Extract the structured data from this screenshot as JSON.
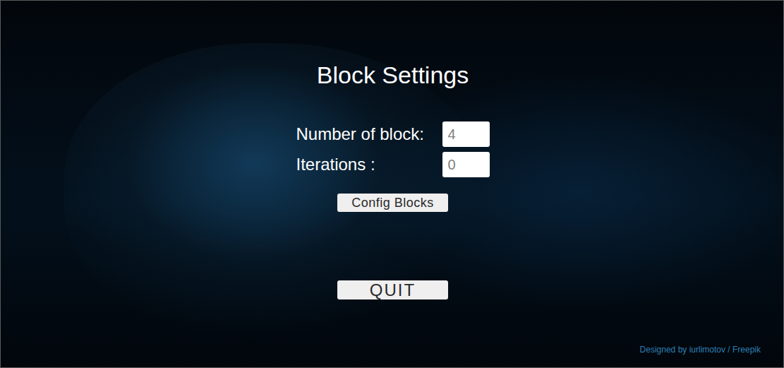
{
  "heading": "Block Settings",
  "fields": [
    {
      "label": "Number of block:",
      "value": "4"
    },
    {
      "label": "Iterations :",
      "value": "0"
    }
  ],
  "buttons": [
    {
      "label": "Config Blocks",
      "kind": "small"
    },
    {
      "label": "QUIT",
      "kind": "large"
    }
  ],
  "credit": "Designed by iurlimotov / Freepik"
}
